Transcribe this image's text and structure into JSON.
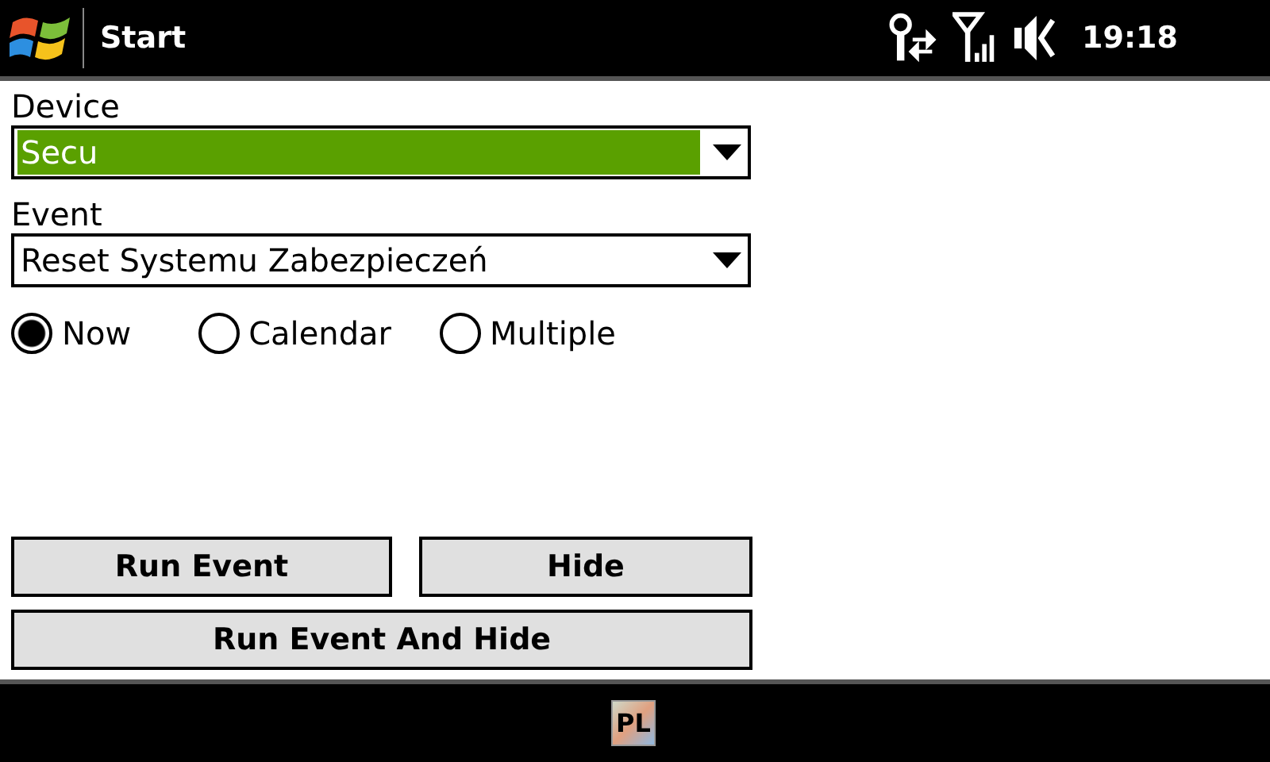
{
  "title_bar": {
    "title": "Start",
    "time": "19:18"
  },
  "fields": [
    {
      "label": "Device",
      "value": "Secu",
      "highlighted": true
    },
    {
      "label": "Event",
      "value": "Reset Systemu Zabezpieczeń",
      "highlighted": false
    }
  ],
  "timing": [
    {
      "label": "Now",
      "selected": true
    },
    {
      "label": "Calendar",
      "selected": false
    },
    {
      "label": "Multiple",
      "selected": false
    }
  ],
  "buttons": [
    {
      "label": "Run Event"
    },
    {
      "label": "Hide"
    },
    {
      "label": "Run Event And Hide"
    }
  ],
  "input_language": "PL"
}
